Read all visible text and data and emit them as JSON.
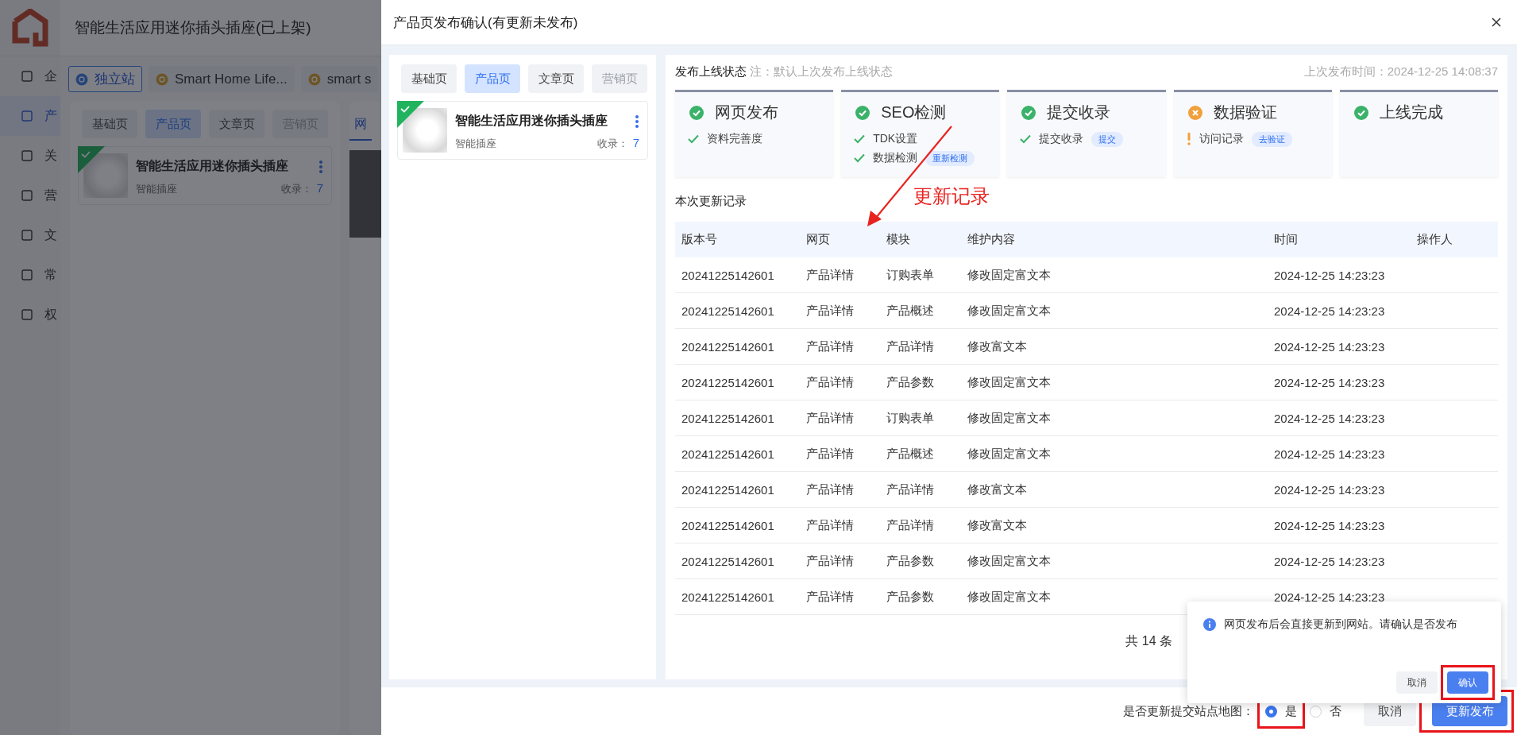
{
  "background_app": {
    "title": "智能生活应用迷你插头插座(已上架)",
    "sidebar": [
      {
        "label": "企",
        "selected": false
      },
      {
        "label": "产",
        "selected": true
      },
      {
        "label": "关",
        "selected": false
      },
      {
        "label": "营",
        "selected": false
      },
      {
        "label": "文",
        "selected": false
      },
      {
        "label": "常",
        "selected": false
      },
      {
        "label": "权",
        "selected": false
      }
    ],
    "sites": [
      {
        "label": "独立站",
        "selected": true
      },
      {
        "label": "Smart Home Life...",
        "selected": false
      },
      {
        "label": "smart s",
        "selected": false
      }
    ],
    "page_tabs": [
      {
        "label": "基础页",
        "selected": false,
        "disabled": false
      },
      {
        "label": "产品页",
        "selected": true,
        "disabled": false
      },
      {
        "label": "文章页",
        "selected": false,
        "disabled": false
      },
      {
        "label": "营销页",
        "selected": false,
        "disabled": true
      }
    ],
    "product_card": {
      "name": "智能生活应用迷你插头插座",
      "category": "智能插座",
      "count_label": "收录：",
      "count": "7",
      "published": true
    },
    "preview_tab": "网"
  },
  "dialog": {
    "title": "产品页发布确认(有更新未发布)",
    "page_tabs": [
      {
        "label": "基础页",
        "selected": false,
        "disabled": false
      },
      {
        "label": "产品页",
        "selected": true,
        "disabled": false
      },
      {
        "label": "文章页",
        "selected": false,
        "disabled": false
      },
      {
        "label": "营销页",
        "selected": false,
        "disabled": true
      }
    ],
    "product_card": {
      "name": "智能生活应用迷你插头插座",
      "category": "智能插座",
      "count_label": "收录：",
      "count": "7",
      "published": true
    },
    "status": {
      "label": "发布上线状态",
      "note": "注：默认上次发布上线状态",
      "last_publish": "上次发布时间：2024-12-25 14:08:37"
    },
    "stages": [
      {
        "title": "网页发布",
        "done": true,
        "items": [
          {
            "kind": "check",
            "label": "资料完善度"
          }
        ]
      },
      {
        "title": "SEO检测",
        "done": true,
        "items": [
          {
            "kind": "check",
            "label": "TDK设置"
          },
          {
            "kind": "check",
            "label": "数据检测",
            "tag": "重新检测"
          }
        ]
      },
      {
        "title": "提交收录",
        "done": true,
        "items": [
          {
            "kind": "check",
            "label": "提交收录",
            "tag": "提交"
          }
        ]
      },
      {
        "title": "数据验证",
        "done": false,
        "items": [
          {
            "kind": "warn",
            "label": "访问记录",
            "tag": "去验证"
          }
        ]
      },
      {
        "title": "上线完成",
        "done": true
      }
    ],
    "records": {
      "title": "本次更新记录",
      "columns": [
        "版本号",
        "网页",
        "模块",
        "维护内容",
        "时间",
        "操作人"
      ],
      "rows": [
        [
          "20241225142601",
          "产品详情",
          "订购表单",
          "修改固定富文本",
          "2024-12-25 14:23:23"
        ],
        [
          "20241225142601",
          "产品详情",
          "产品概述",
          "修改固定富文本",
          "2024-12-25 14:23:23"
        ],
        [
          "20241225142601",
          "产品详情",
          "产品详情",
          "修改富文本",
          "2024-12-25 14:23:23"
        ],
        [
          "20241225142601",
          "产品详情",
          "产品参数",
          "修改固定富文本",
          "2024-12-25 14:23:23"
        ],
        [
          "20241225142601",
          "产品详情",
          "订购表单",
          "修改固定富文本",
          "2024-12-25 14:23:23"
        ],
        [
          "20241225142601",
          "产品详情",
          "产品概述",
          "修改固定富文本",
          "2024-12-25 14:23:23"
        ],
        [
          "20241225142601",
          "产品详情",
          "产品详情",
          "修改富文本",
          "2024-12-25 14:23:23"
        ],
        [
          "20241225142601",
          "产品详情",
          "产品详情",
          "修改富文本",
          "2024-12-25 14:23:23"
        ],
        [
          "20241225142601",
          "产品详情",
          "产品参数",
          "修改固定富文本",
          "2024-12-25 14:23:23"
        ],
        [
          "20241225142601",
          "产品详情",
          "产品参数",
          "修改固定富文本",
          "2024-12-25 14:23:23"
        ]
      ]
    },
    "pagination": {
      "total": "共 14 条"
    },
    "popconfirm": {
      "message": "网页发布后会直接更新到网站。请确认是否发布",
      "cancel": "取消",
      "confirm": "确认"
    },
    "footer": {
      "sitemap_label": "是否更新提交站点地图：",
      "options": [
        {
          "label": "是",
          "selected": true
        },
        {
          "label": "否",
          "selected": false
        }
      ],
      "cancel": "取消",
      "submit": "更新发布"
    }
  },
  "annotation": {
    "label": "更新记录"
  }
}
